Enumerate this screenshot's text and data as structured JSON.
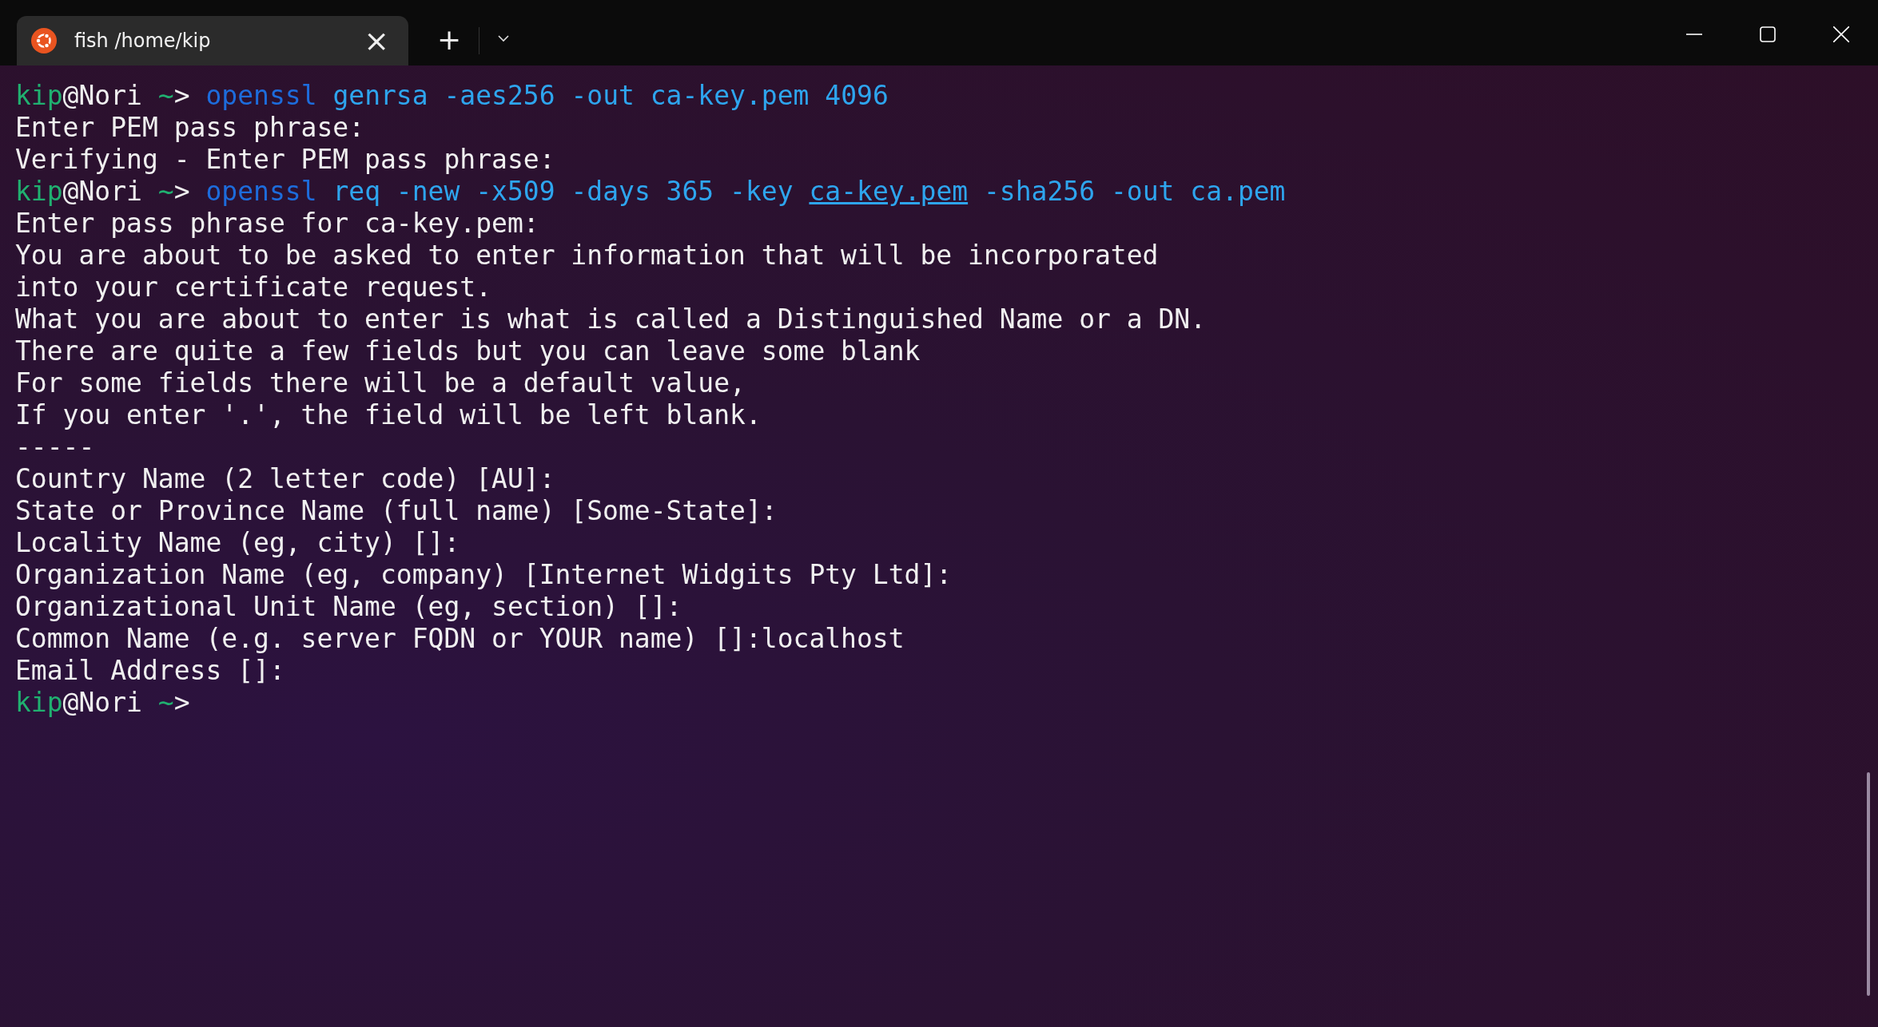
{
  "tab": {
    "title": "fish /home/kip",
    "close": "×",
    "selected": true
  },
  "new_tab": "+",
  "lines": [
    {
      "segments": [
        {
          "text": "kip",
          "kind": "user"
        },
        {
          "text": "@Nori ",
          "kind": "plain"
        },
        {
          "text": "~",
          "kind": "user"
        },
        {
          "text": "> ",
          "kind": "plain"
        },
        {
          "text": "openssl",
          "kind": "cmd"
        },
        {
          "text": " genrsa -aes256 -out ca-key.pem 4096",
          "kind": "arg"
        }
      ]
    },
    {
      "segments": [
        {
          "text": "Enter PEM pass phrase:",
          "kind": "plain"
        }
      ]
    },
    {
      "segments": [
        {
          "text": "Verifying - Enter PEM pass phrase:",
          "kind": "plain"
        }
      ]
    },
    {
      "segments": [
        {
          "text": "kip",
          "kind": "user"
        },
        {
          "text": "@Nori ",
          "kind": "plain"
        },
        {
          "text": "~",
          "kind": "user"
        },
        {
          "text": "> ",
          "kind": "plain"
        },
        {
          "text": "openssl",
          "kind": "cmd"
        },
        {
          "text": " req -new -x509 -days 365 -key ",
          "kind": "arg"
        },
        {
          "text": "ca-key.pem",
          "kind": "link"
        },
        {
          "text": " -sha256 -out ca.pem",
          "kind": "arg"
        }
      ]
    },
    {
      "segments": [
        {
          "text": "Enter pass phrase for ca-key.pem:",
          "kind": "plain"
        }
      ]
    },
    {
      "segments": [
        {
          "text": "You are about to be asked to enter information that will be incorporated",
          "kind": "plain"
        }
      ]
    },
    {
      "segments": [
        {
          "text": "into your certificate request.",
          "kind": "plain"
        }
      ]
    },
    {
      "segments": [
        {
          "text": "What you are about to enter is what is called a Distinguished Name or a DN.",
          "kind": "plain"
        }
      ]
    },
    {
      "segments": [
        {
          "text": "There are quite a few fields but you can leave some blank",
          "kind": "plain"
        }
      ]
    },
    {
      "segments": [
        {
          "text": "For some fields there will be a default value,",
          "kind": "plain"
        }
      ]
    },
    {
      "segments": [
        {
          "text": "If you enter '.', the field will be left blank.",
          "kind": "plain"
        }
      ]
    },
    {
      "segments": [
        {
          "text": "-----",
          "kind": "plain"
        }
      ]
    },
    {
      "segments": [
        {
          "text": "Country Name (2 letter code) [AU]:",
          "kind": "plain"
        }
      ]
    },
    {
      "segments": [
        {
          "text": "State or Province Name (full name) [Some-State]:",
          "kind": "plain"
        }
      ]
    },
    {
      "segments": [
        {
          "text": "Locality Name (eg, city) []:",
          "kind": "plain"
        }
      ]
    },
    {
      "segments": [
        {
          "text": "Organization Name (eg, company) [Internet Widgits Pty Ltd]:",
          "kind": "plain"
        }
      ]
    },
    {
      "segments": [
        {
          "text": "Organizational Unit Name (eg, section) []:",
          "kind": "plain"
        }
      ]
    },
    {
      "segments": [
        {
          "text": "Common Name (e.g. server FQDN or YOUR name) []:localhost",
          "kind": "plain"
        }
      ]
    },
    {
      "segments": [
        {
          "text": "Email Address []:",
          "kind": "plain"
        }
      ]
    },
    {
      "segments": [
        {
          "text": "kip",
          "kind": "user"
        },
        {
          "text": "@Nori ",
          "kind": "plain"
        },
        {
          "text": "~",
          "kind": "user"
        },
        {
          "text": ">",
          "kind": "plain"
        }
      ]
    }
  ]
}
